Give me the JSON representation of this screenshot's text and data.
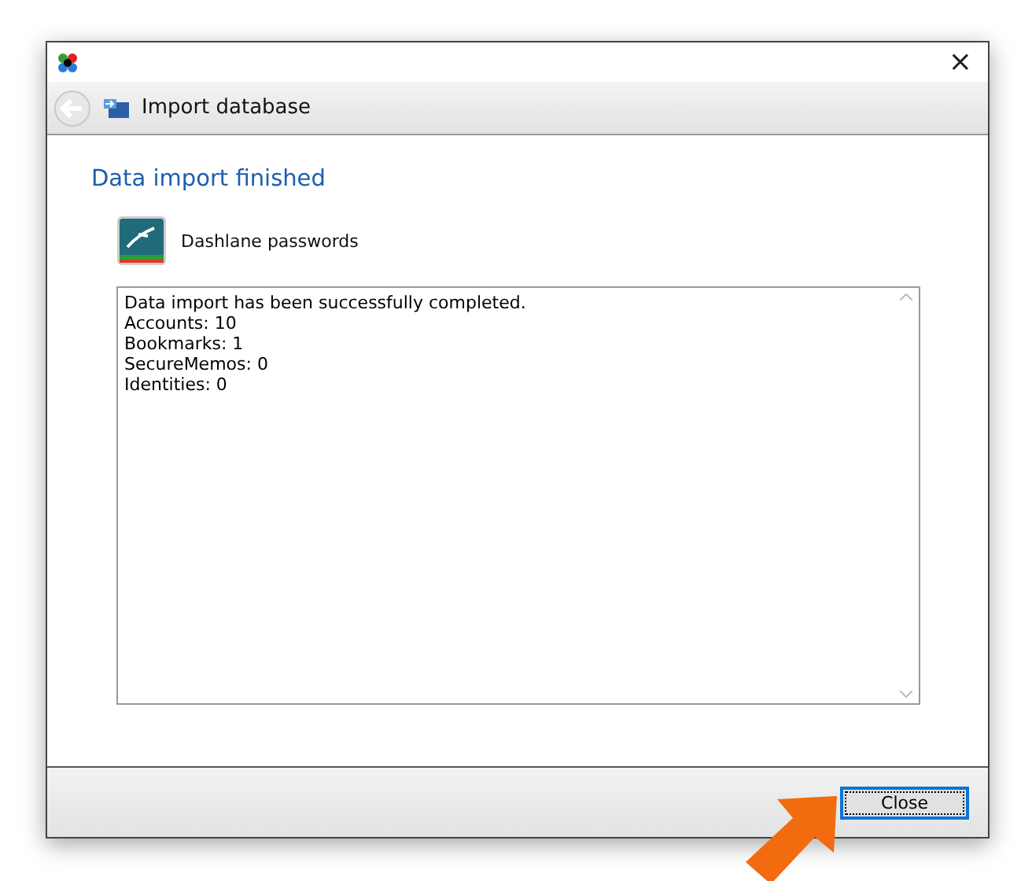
{
  "window": {
    "close": "×"
  },
  "nav": {
    "title": "Import database"
  },
  "heading": "Data import finished",
  "source": {
    "name": "Dashlane passwords"
  },
  "log": [
    "Data import has been successfully completed.",
    "Accounts: 10",
    "Bookmarks: 1",
    "SecureMemos: 0",
    "Identities: 0"
  ],
  "buttons": [
    {
      "label": "Close",
      "focused": true
    }
  ]
}
